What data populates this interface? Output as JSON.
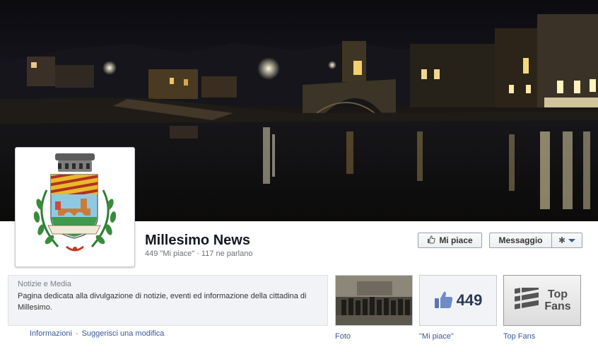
{
  "page": {
    "name": "Millesimo News",
    "likes_count_text": "449 \"Mi piace\"",
    "talking_text": "117 ne parlano",
    "separator": "·"
  },
  "actions": {
    "like_label": "Mi piace",
    "message_label": "Messaggio",
    "gear_icon": "gear-icon",
    "dropdown_icon": "caret-down-icon"
  },
  "about": {
    "category": "Notizie e Media",
    "description": "Pagina dedicata alla divulgazione di notizie, eventi ed informazione della cittadina di Millesimo.",
    "links": {
      "info": "Informazioni",
      "separator": "-",
      "suggest": "Suggerisci una modifica"
    }
  },
  "tiles": [
    {
      "label": "Foto",
      "icon": "photo-thumbnail"
    },
    {
      "label": "\"Mi piace\"",
      "value": "449",
      "icon": "thumbs-up-icon"
    },
    {
      "label": "Top Fans",
      "value_line1": "Top",
      "value_line2": "Fans",
      "icon": "top-fans-icon"
    }
  ],
  "colors": {
    "link": "#3b5998",
    "name": "#141823",
    "about_bg": "#f2f3f6"
  }
}
